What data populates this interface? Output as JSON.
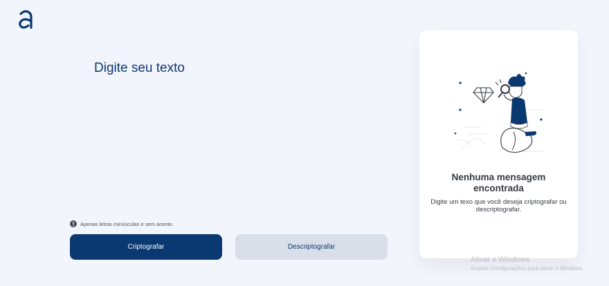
{
  "brand": {
    "logo_icon": "alura-a-logo-icon",
    "accent": "#0a3871"
  },
  "editor": {
    "placeholder": "Digite seu texto"
  },
  "hint": {
    "icon": "exclamation-circle-icon",
    "text": "Apenas letras minúsculas e sem acento."
  },
  "buttons": {
    "encrypt_label": "Criptografar",
    "decrypt_label": "Descriptografar"
  },
  "output_panel": {
    "illustration": "boy-with-magnifier-and-diamond-illustration",
    "title_line1": "Nenhuma mensagem",
    "title_line2": "encontrada",
    "message": "Digite um texo que você deseja criptografar ou descriptografar."
  },
  "watermark": {
    "title": "Ativar o Windows",
    "subtitle": "Acesse Configurações para ativar o Windows."
  },
  "colors": {
    "background": "#f3f5fc",
    "primary_button": "#0a3871",
    "secondary_button": "#d8dfe8",
    "panel_bg": "#ffffff"
  }
}
